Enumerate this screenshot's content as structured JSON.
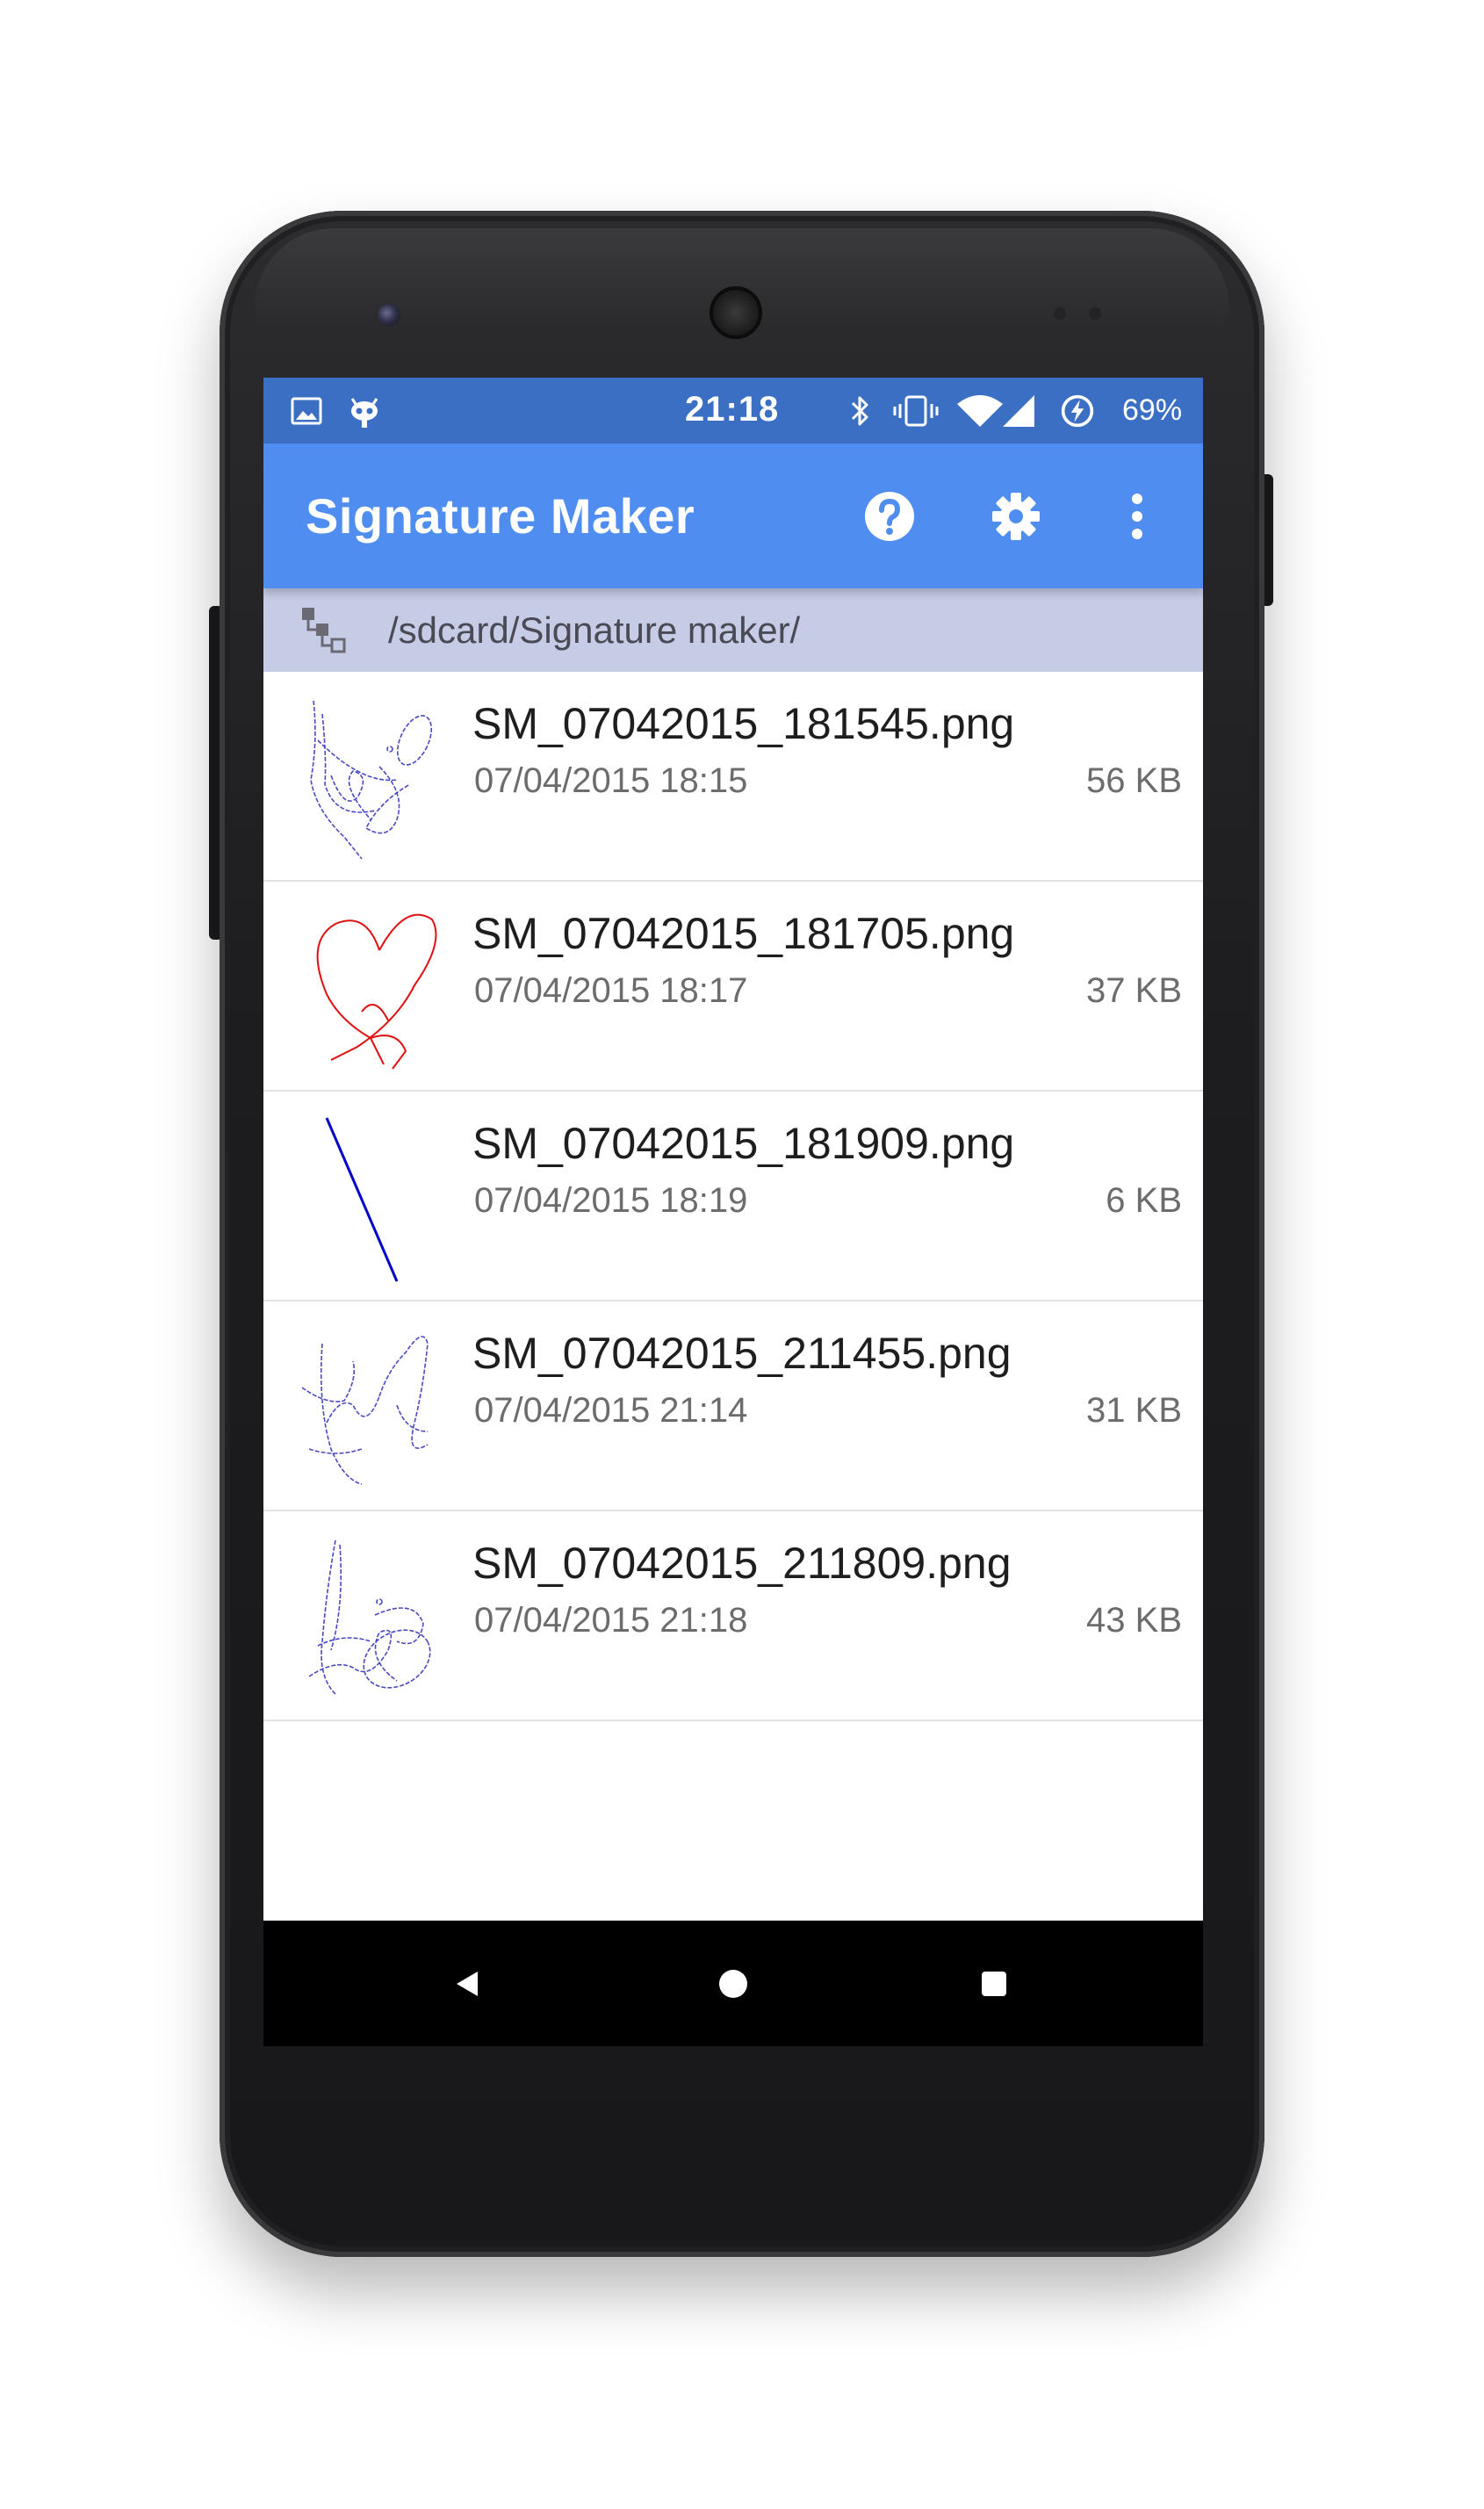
{
  "status_bar": {
    "time": "21:18",
    "battery_percent": "69%",
    "icons": [
      "image-notification-icon",
      "cyanogen-mod-icon",
      "bluetooth-icon",
      "vibrate-icon",
      "wifi-icon",
      "signal-icon",
      "battery-charging-icon"
    ]
  },
  "app_bar": {
    "title": "Signature Maker",
    "actions": [
      "help-icon",
      "settings-icon",
      "overflow-menu-icon"
    ]
  },
  "path_bar": {
    "path": "/sdcard/Signature maker/",
    "icon": "folder-tree-icon"
  },
  "files": [
    {
      "name": "SM_07042015_181545.png",
      "date": "07/04/2015 18:15",
      "size": "56 KB",
      "thumb_color": "#4a4ac0"
    },
    {
      "name": "SM_07042015_181705.png",
      "date": "07/04/2015 18:17",
      "size": "37 KB",
      "thumb_color": "#e01010"
    },
    {
      "name": "SM_07042015_181909.png",
      "date": "07/04/2015 18:19",
      "size": "6 KB",
      "thumb_color": "#0000cc"
    },
    {
      "name": "SM_07042015_211455.png",
      "date": "07/04/2015 21:14",
      "size": "31 KB",
      "thumb_color": "#4a4ac0"
    },
    {
      "name": "SM_07042015_211809.png",
      "date": "07/04/2015 21:18",
      "size": "43 KB",
      "thumb_color": "#4a4ac0"
    }
  ],
  "nav_bar": {
    "buttons": [
      "back-icon",
      "home-icon",
      "recents-icon"
    ]
  },
  "colors": {
    "status_bar": "#3a6fc4",
    "app_bar": "#4f8ef0",
    "path_bar": "#c6cbe6"
  }
}
